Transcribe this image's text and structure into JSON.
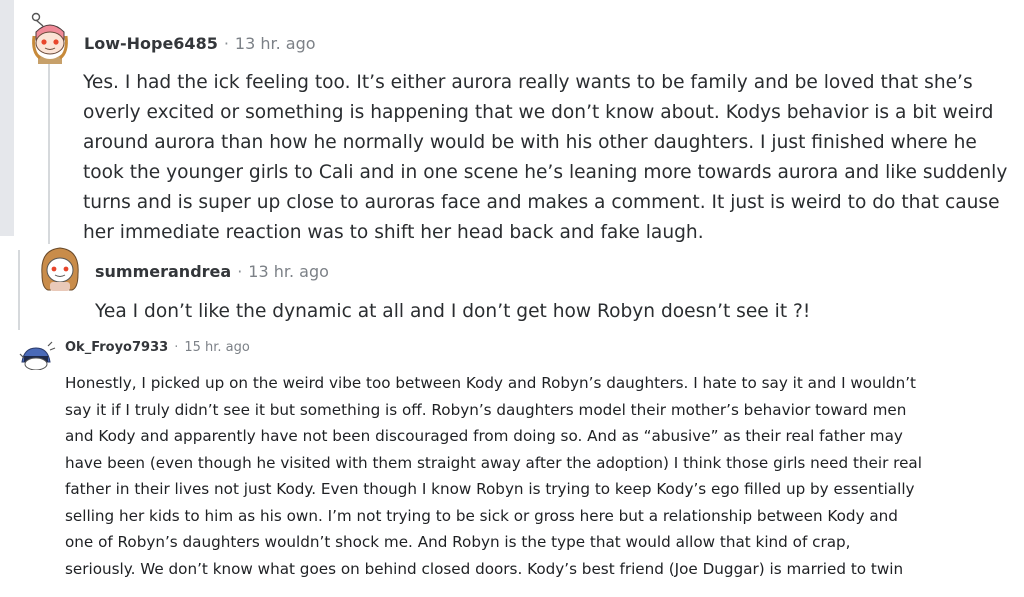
{
  "comments": [
    {
      "username": "Low-Hope6485",
      "separator": "·",
      "time": "13 hr. ago",
      "avatar_icon": "snoo-avatar-pink-hat-icon",
      "body": "Yes. I had the ick feeling too. It’s either aurora really wants to be family and be loved that she’s overly excited or something is happening that we don’t know about. Kodys behavior is a bit weird around aurora than how he normally would be with his other daughters. I just finished where he took the younger girls to Cali and in one scene he’s leaning more towards aurora and like suddenly turns and is super up close to auroras face and makes a comment. It just is weird to do that cause her immediate reaction was to shift her head back and fake laugh."
    },
    {
      "username": "summerandrea",
      "separator": "·",
      "time": "13 hr. ago",
      "avatar_icon": "snoo-avatar-brown-hair-icon",
      "body": "Yea I don’t like the dynamic at all and I don’t get how Robyn doesn’t see it ?!"
    },
    {
      "username": "Ok_Froyo7933",
      "separator": "·",
      "time": "15 hr. ago",
      "avatar_icon": "snoo-avatar-blue-icon",
      "body": "Honestly, I picked up on the weird vibe too between Kody and Robyn’s daughters. I hate to say it and I wouldn’t say it if I truly didn’t see it but something is off. Robyn’s daughters model their mother’s behavior toward men and Kody and apparently have not been discouraged from doing so. And as “abusive” as their real father may have been (even though he visited with them straight away after the adoption) I think those girls need their real father in their lives not just Kody. Even though I know Robyn is trying to keep Kody’s ego filled up by essentially selling her kids to him as his own. I’m not trying to be sick or gross here but a relationship between Kody and one of Robyn’s daughters wouldn’t shock me. And Robyn is the type that would allow that kind of crap, seriously. We don’t know what goes on behind closed doors. Kody’s best friend (Joe Duggar) is married to twin"
    }
  ],
  "colors": {
    "username": "#33363a",
    "timestamp": "#7c8187",
    "thread_line": "#d6d9dc",
    "side_bar": "#e5e7eb"
  }
}
